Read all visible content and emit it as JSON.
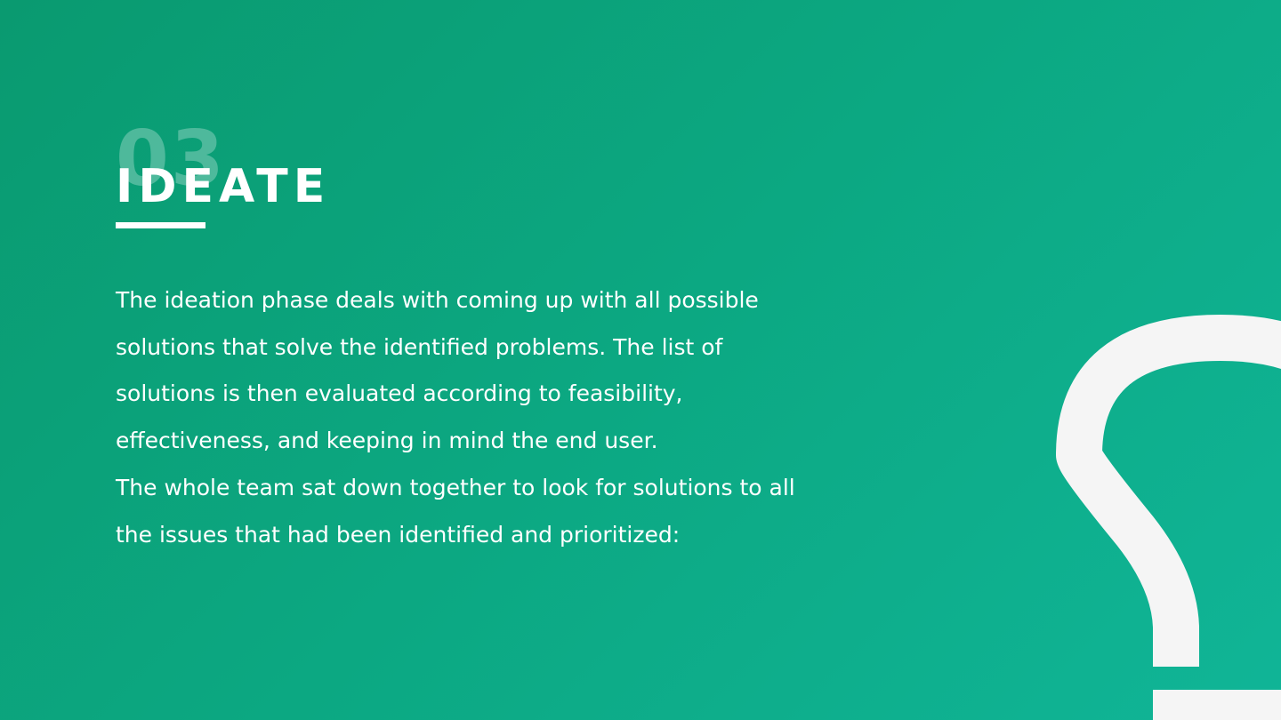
{
  "slide": {
    "number": "03",
    "title": "IDEATE",
    "paragraphs": [
      "The ideation phase deals with coming up with all possible solutions that solve the identified problems. The list of solutions is then evaluated according to feasibility, effectiveness, and keeping in mind the end user.",
      "The whole team sat down together to look for solutions to all the issues that had been identified and prioritized:"
    ]
  },
  "icons": {
    "decoration": "lightbulb-icon"
  },
  "colors": {
    "background_start": "#0a9a70",
    "background_end": "#10b597",
    "text": "#ffffff",
    "bulb": "#f5f5f5"
  }
}
